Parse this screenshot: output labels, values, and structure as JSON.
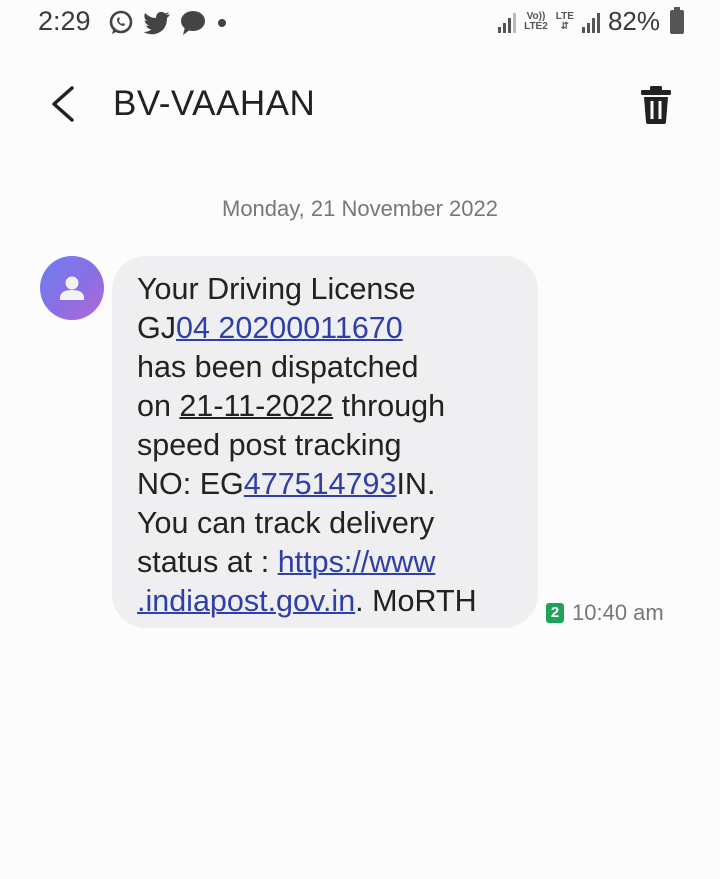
{
  "status_bar": {
    "time": "2:29",
    "network_top": "Vo))",
    "network_bottom": "LTE2",
    "lte": "LTE",
    "battery": "82%",
    "icons": [
      "whatsapp-icon",
      "twitter-icon",
      "chat-icon",
      "dot-icon",
      "signal-icon",
      "signal-icon",
      "battery-icon"
    ]
  },
  "header": {
    "title": "BV-VAAHAN",
    "back_icon": "back-arrow-icon",
    "delete_icon": "trash-icon"
  },
  "conversation": {
    "date": "Monday, 21 November 2022",
    "message": {
      "l1": "Your Driving License",
      "l2_prefix": "GJ",
      "l2_link": "04 20200011670",
      "l3": "has been dispatched",
      "l4_prefix": "on ",
      "l4_date": "21-11-2022",
      "l4_suffix": " through",
      "l5": "speed post tracking",
      "l6_prefix": "NO: EG",
      "l6_link": "477514793",
      "l6_suffix": "IN.",
      "l7": "You can track delivery",
      "l8_prefix": "status at : ",
      "l8_link": "https://www",
      "l9_link": ".indiapost.gov.in",
      "l9_suffix": ". MoRTH",
      "sim": "2",
      "time": "10:40 am"
    }
  },
  "colors": {
    "bubble": "#efeff1",
    "link": "#2f3fa8",
    "sim_badge": "#1fa35a"
  }
}
